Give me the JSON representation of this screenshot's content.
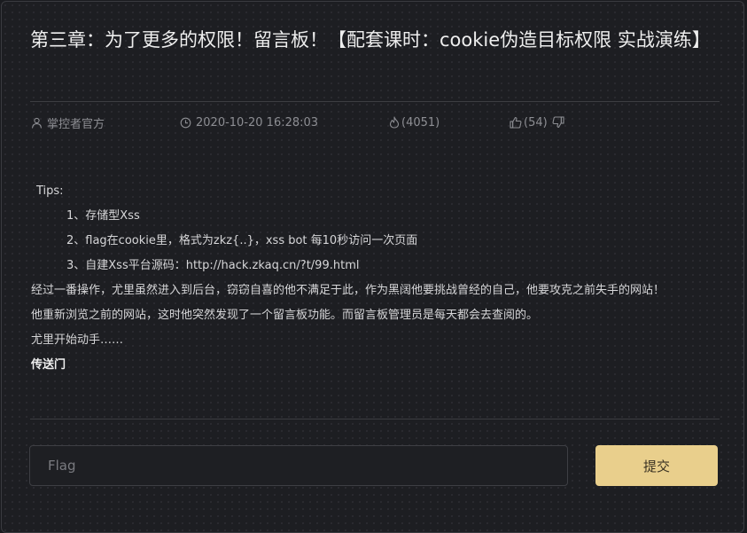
{
  "article": {
    "title": "第三章：为了更多的权限！留言板！【配套课时：cookie伪造目标权限 实战演练】",
    "meta": {
      "author": "掌控者官方",
      "datetime": "2020-10-20 16:28:03",
      "views": "(4051)",
      "likes": "(54)"
    },
    "content": {
      "tips_label": "Tips:",
      "tips": [
        "1、存储型Xss",
        "2、flag在cookie里，格式为zkz{..}，xss bot 每10秒访问一次页面",
        "3、自建Xss平台源码：http://hack.zkaq.cn/?t/99.html"
      ],
      "paragraphs": [
        "经过一番操作，尤里虽然进入到后台，窃窃自喜的他不满足于此，作为黑阔他要挑战曾经的自己，他要攻克之前失手的网站！",
        "他重新浏览之前的网站，这时他突然发现了一个留言板功能。而留言板管理员是每天都会去查阅的。",
        "尤里开始动手……"
      ],
      "link": "传送门"
    }
  },
  "form": {
    "flag_placeholder": "Flag",
    "flag_value": "",
    "submit_label": "提交"
  },
  "colors": {
    "background": "#1d1e22",
    "accent_button": "#e9cf8c",
    "meta_text": "#8d8e93"
  },
  "icons": {
    "author": "user-icon",
    "datetime": "clock-icon",
    "views": "flame-icon",
    "like": "thumbs-up-icon",
    "dislike": "thumbs-down-icon"
  }
}
